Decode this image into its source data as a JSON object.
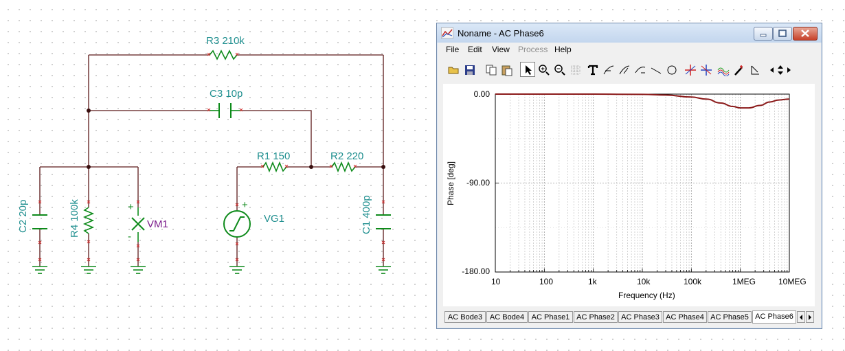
{
  "schematic": {
    "r3": "R3 210k",
    "c3": "C3 10p",
    "r1": "R1 150",
    "r2": "R2 220",
    "c2": "C2 20p",
    "r4": "R4 100k",
    "vm1": "VM1",
    "vg1": "VG1",
    "c1": "C1 400p",
    "plus": "+",
    "minus": "-"
  },
  "window": {
    "title": "Noname - AC Phase6",
    "menu": [
      "File",
      "Edit",
      "View",
      "Process",
      "Help"
    ],
    "plot": {
      "ylabel": "Phase [deg]",
      "xlabel": "Frequency (Hz)",
      "yticks": [
        "0.00",
        "-90.00",
        "-180.00"
      ],
      "xticks": [
        "10",
        "100",
        "1k",
        "10k",
        "100k",
        "1MEG",
        "10MEG"
      ]
    },
    "tabs": [
      "AC Bode3",
      "AC Bode4",
      "AC Phase1",
      "AC Phase2",
      "AC Phase3",
      "AC Phase4",
      "AC Phase5",
      "AC Phase6"
    ],
    "active_tab": "AC Phase6"
  },
  "chart_data": {
    "type": "line",
    "xscale": "log",
    "xlim": [
      10,
      10000000
    ],
    "ylim": [
      -180,
      0
    ],
    "grid": true,
    "xlabel": "Frequency (Hz)",
    "ylabel": "Phase [deg]",
    "series": [
      {
        "color": "#8b1a1a",
        "x": [
          10,
          100,
          1000,
          10000,
          30000,
          100000,
          200000,
          400000,
          700000,
          1000000,
          1500000,
          2500000,
          4000000,
          6000000,
          10000000
        ],
        "y": [
          0,
          0,
          0,
          -0.3,
          -1,
          -3,
          -5,
          -9,
          -12.5,
          -14,
          -14,
          -11.5,
          -8,
          -6,
          -5
        ]
      }
    ]
  },
  "colors": {
    "wire": "#5a1818",
    "component": "#0d8a1a",
    "label": "#1f8f8f",
    "meter_label": "#7a1a8a",
    "curve": "#8b1a1a"
  }
}
